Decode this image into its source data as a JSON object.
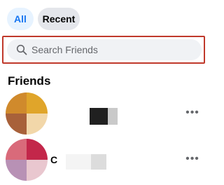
{
  "filters": {
    "all_label": "All",
    "recent_label": "Recent"
  },
  "search": {
    "placeholder": "Search Friends",
    "value": ""
  },
  "section_title": "Friends",
  "friends": [
    {
      "name": "",
      "more_label": "•••"
    },
    {
      "name": "C",
      "more_label": "•••"
    }
  ],
  "colors": {
    "accent": "#1877f2",
    "chip_active_bg": "#e7f3ff",
    "chip_inactive_bg": "#e4e6eb",
    "search_bg": "#f0f2f5",
    "highlight": "#c0392b"
  },
  "icons": {
    "search": "search-icon",
    "more": "more-options-icon"
  }
}
